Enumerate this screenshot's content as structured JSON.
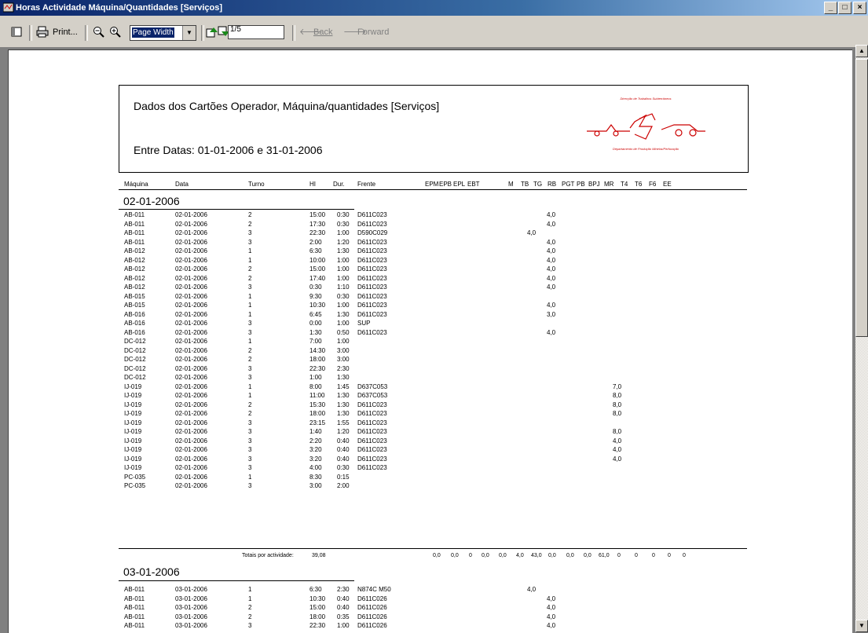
{
  "window": {
    "title": "Horas Actividade Máquina/Quantidades [Serviços]",
    "controls": [
      "_",
      "□",
      "×"
    ]
  },
  "toolbar": {
    "print_label": "Print...",
    "zoom_value": "Page Width",
    "page_value": "1/5",
    "back_label": "Back",
    "forward_label": "Forward"
  },
  "report": {
    "title": "Dados dos Cartões Operador, Máquina/quantidades [Serviços]",
    "date_range": "Entre Datas: 01-01-2006 e 31-01-2006",
    "logo_top_text": "Direcção de Trabalhos Subterrâneos",
    "logo_bottom_text": "Departamento de Produção Mineira/Perfuração",
    "columns": [
      "Máquina",
      "Data",
      "Turno",
      "HI",
      "Dur.",
      "Frente",
      "EPM",
      "EPB",
      "EPL",
      "EBT",
      "M",
      "TB",
      "TG",
      "RB",
      "PGT",
      "PB",
      "BPJ",
      "MR",
      "T4",
      "T6",
      "F6",
      "EE"
    ],
    "groups": [
      {
        "date": "02-01-2006",
        "rows": [
          {
            "m": "AB-011",
            "d": "02-01-2006",
            "t": "2",
            "hi": "15:00",
            "dur": "0:30",
            "f": "D611C023",
            "tb": "",
            "tg": "4,0",
            "bpj": ""
          },
          {
            "m": "AB-011",
            "d": "02-01-2006",
            "t": "2",
            "hi": "17:30",
            "dur": "0:30",
            "f": "D611C023",
            "tb": "",
            "tg": "4,0",
            "bpj": ""
          },
          {
            "m": "AB-011",
            "d": "02-01-2006",
            "t": "3",
            "hi": "22:30",
            "dur": "1:00",
            "f": "D590C029",
            "tb": "4,0",
            "tg": "",
            "bpj": ""
          },
          {
            "m": "AB-011",
            "d": "02-01-2006",
            "t": "3",
            "hi": "2:00",
            "dur": "1:20",
            "f": "D611C023",
            "tb": "",
            "tg": "4,0",
            "bpj": ""
          },
          {
            "m": "AB-012",
            "d": "02-01-2006",
            "t": "1",
            "hi": "6:30",
            "dur": "1:30",
            "f": "D611C023",
            "tb": "",
            "tg": "4,0",
            "bpj": ""
          },
          {
            "m": "AB-012",
            "d": "02-01-2006",
            "t": "1",
            "hi": "10:00",
            "dur": "1:00",
            "f": "D611C023",
            "tb": "",
            "tg": "4,0",
            "bpj": ""
          },
          {
            "m": "AB-012",
            "d": "02-01-2006",
            "t": "2",
            "hi": "15:00",
            "dur": "1:00",
            "f": "D611C023",
            "tb": "",
            "tg": "4,0",
            "bpj": ""
          },
          {
            "m": "AB-012",
            "d": "02-01-2006",
            "t": "2",
            "hi": "17:40",
            "dur": "1:00",
            "f": "D611C023",
            "tb": "",
            "tg": "4,0",
            "bpj": ""
          },
          {
            "m": "AB-012",
            "d": "02-01-2006",
            "t": "3",
            "hi": "0:30",
            "dur": "1:10",
            "f": "D611C023",
            "tb": "",
            "tg": "4,0",
            "bpj": ""
          },
          {
            "m": "AB-015",
            "d": "02-01-2006",
            "t": "1",
            "hi": "9:30",
            "dur": "0:30",
            "f": "D611C023",
            "tb": "",
            "tg": "",
            "bpj": ""
          },
          {
            "m": "AB-015",
            "d": "02-01-2006",
            "t": "1",
            "hi": "10:30",
            "dur": "1:00",
            "f": "D611C023",
            "tb": "",
            "tg": "4,0",
            "bpj": ""
          },
          {
            "m": "AB-016",
            "d": "02-01-2006",
            "t": "1",
            "hi": "6:45",
            "dur": "1:30",
            "f": "D611C023",
            "tb": "",
            "tg": "3,0",
            "bpj": ""
          },
          {
            "m": "AB-016",
            "d": "02-01-2006",
            "t": "3",
            "hi": "0:00",
            "dur": "1:00",
            "f": "SUP",
            "tb": "",
            "tg": "",
            "bpj": ""
          },
          {
            "m": "AB-016",
            "d": "02-01-2006",
            "t": "3",
            "hi": "1:30",
            "dur": "0:50",
            "f": "D611C023",
            "tb": "",
            "tg": "4,0",
            "bpj": ""
          },
          {
            "m": "DC-012",
            "d": "02-01-2006",
            "t": "1",
            "hi": "7:00",
            "dur": "1:00",
            "f": "",
            "tb": "",
            "tg": "",
            "bpj": ""
          },
          {
            "m": "DC-012",
            "d": "02-01-2006",
            "t": "2",
            "hi": "14:30",
            "dur": "3:00",
            "f": "",
            "tb": "",
            "tg": "",
            "bpj": ""
          },
          {
            "m": "DC-012",
            "d": "02-01-2006",
            "t": "2",
            "hi": "18:00",
            "dur": "3:00",
            "f": "",
            "tb": "",
            "tg": "",
            "bpj": ""
          },
          {
            "m": "DC-012",
            "d": "02-01-2006",
            "t": "3",
            "hi": "22:30",
            "dur": "2:30",
            "f": "",
            "tb": "",
            "tg": "",
            "bpj": ""
          },
          {
            "m": "DC-012",
            "d": "02-01-2006",
            "t": "3",
            "hi": "1:00",
            "dur": "1:30",
            "f": "",
            "tb": "",
            "tg": "",
            "bpj": ""
          },
          {
            "m": "IJ-019",
            "d": "02-01-2006",
            "t": "1",
            "hi": "8:00",
            "dur": "1:45",
            "f": "D637C053",
            "tb": "",
            "tg": "",
            "bpj": "7,0"
          },
          {
            "m": "IJ-019",
            "d": "02-01-2006",
            "t": "1",
            "hi": "11:00",
            "dur": "1:30",
            "f": "D637C053",
            "tb": "",
            "tg": "",
            "bpj": "8,0"
          },
          {
            "m": "IJ-019",
            "d": "02-01-2006",
            "t": "2",
            "hi": "15:30",
            "dur": "1:30",
            "f": "D611C023",
            "tb": "",
            "tg": "",
            "bpj": "8,0"
          },
          {
            "m": "IJ-019",
            "d": "02-01-2006",
            "t": "2",
            "hi": "18:00",
            "dur": "1:30",
            "f": "D611C023",
            "tb": "",
            "tg": "",
            "bpj": "8,0"
          },
          {
            "m": "IJ-019",
            "d": "02-01-2006",
            "t": "3",
            "hi": "23:15",
            "dur": "1:55",
            "f": "D611C023",
            "tb": "",
            "tg": "",
            "bpj": ""
          },
          {
            "m": "IJ-019",
            "d": "02-01-2006",
            "t": "3",
            "hi": "1:40",
            "dur": "1:20",
            "f": "D611C023",
            "tb": "",
            "tg": "",
            "bpj": "8,0"
          },
          {
            "m": "IJ-019",
            "d": "02-01-2006",
            "t": "3",
            "hi": "2:20",
            "dur": "0:40",
            "f": "D611C023",
            "tb": "",
            "tg": "",
            "bpj": "4,0"
          },
          {
            "m": "IJ-019",
            "d": "02-01-2006",
            "t": "3",
            "hi": "3:20",
            "dur": "0:40",
            "f": "D611C023",
            "tb": "",
            "tg": "",
            "bpj": "4,0"
          },
          {
            "m": "IJ-019",
            "d": "02-01-2006",
            "t": "3",
            "hi": "3:20",
            "dur": "0:40",
            "f": "D611C023",
            "tb": "",
            "tg": "",
            "bpj": "4,0"
          },
          {
            "m": "IJ-019",
            "d": "02-01-2006",
            "t": "3",
            "hi": "4:00",
            "dur": "0:30",
            "f": "D611C023",
            "tb": "",
            "tg": "",
            "bpj": ""
          },
          {
            "m": "PC-035",
            "d": "02-01-2006",
            "t": "1",
            "hi": "8:30",
            "dur": "0:15",
            "f": "",
            "tb": "",
            "tg": "",
            "bpj": ""
          },
          {
            "m": "PC-035",
            "d": "02-01-2006",
            "t": "3",
            "hi": "3:00",
            "dur": "2:00",
            "f": "",
            "tb": "",
            "tg": "",
            "bpj": ""
          }
        ],
        "totals_label": "Totais por actividade:",
        "totals_dur": "39,08",
        "totals": [
          "0,0",
          "0,0",
          "0",
          "0,0",
          "0,0",
          "4,0",
          "43,0",
          "0,0",
          "0,0",
          "0,0",
          "61,0",
          "0",
          "0",
          "0",
          "0",
          "0"
        ]
      },
      {
        "date": "03-01-2006",
        "rows": [
          {
            "m": "AB-011",
            "d": "03-01-2006",
            "t": "1",
            "hi": "6:30",
            "dur": "2:30",
            "f": "N874C M50",
            "tb": "4,0",
            "tg": "",
            "bpj": ""
          },
          {
            "m": "AB-011",
            "d": "03-01-2006",
            "t": "1",
            "hi": "10:30",
            "dur": "0:40",
            "f": "D611C026",
            "tb": "",
            "tg": "4,0",
            "bpj": ""
          },
          {
            "m": "AB-011",
            "d": "03-01-2006",
            "t": "2",
            "hi": "15:00",
            "dur": "0:40",
            "f": "D611C026",
            "tb": "",
            "tg": "4,0",
            "bpj": ""
          },
          {
            "m": "AB-011",
            "d": "03-01-2006",
            "t": "2",
            "hi": "18:00",
            "dur": "0:35",
            "f": "D611C026",
            "tb": "",
            "tg": "4,0",
            "bpj": ""
          },
          {
            "m": "AB-011",
            "d": "03-01-2006",
            "t": "3",
            "hi": "22:30",
            "dur": "1:00",
            "f": "D611C026",
            "tb": "",
            "tg": "4,0",
            "bpj": ""
          }
        ]
      }
    ]
  }
}
